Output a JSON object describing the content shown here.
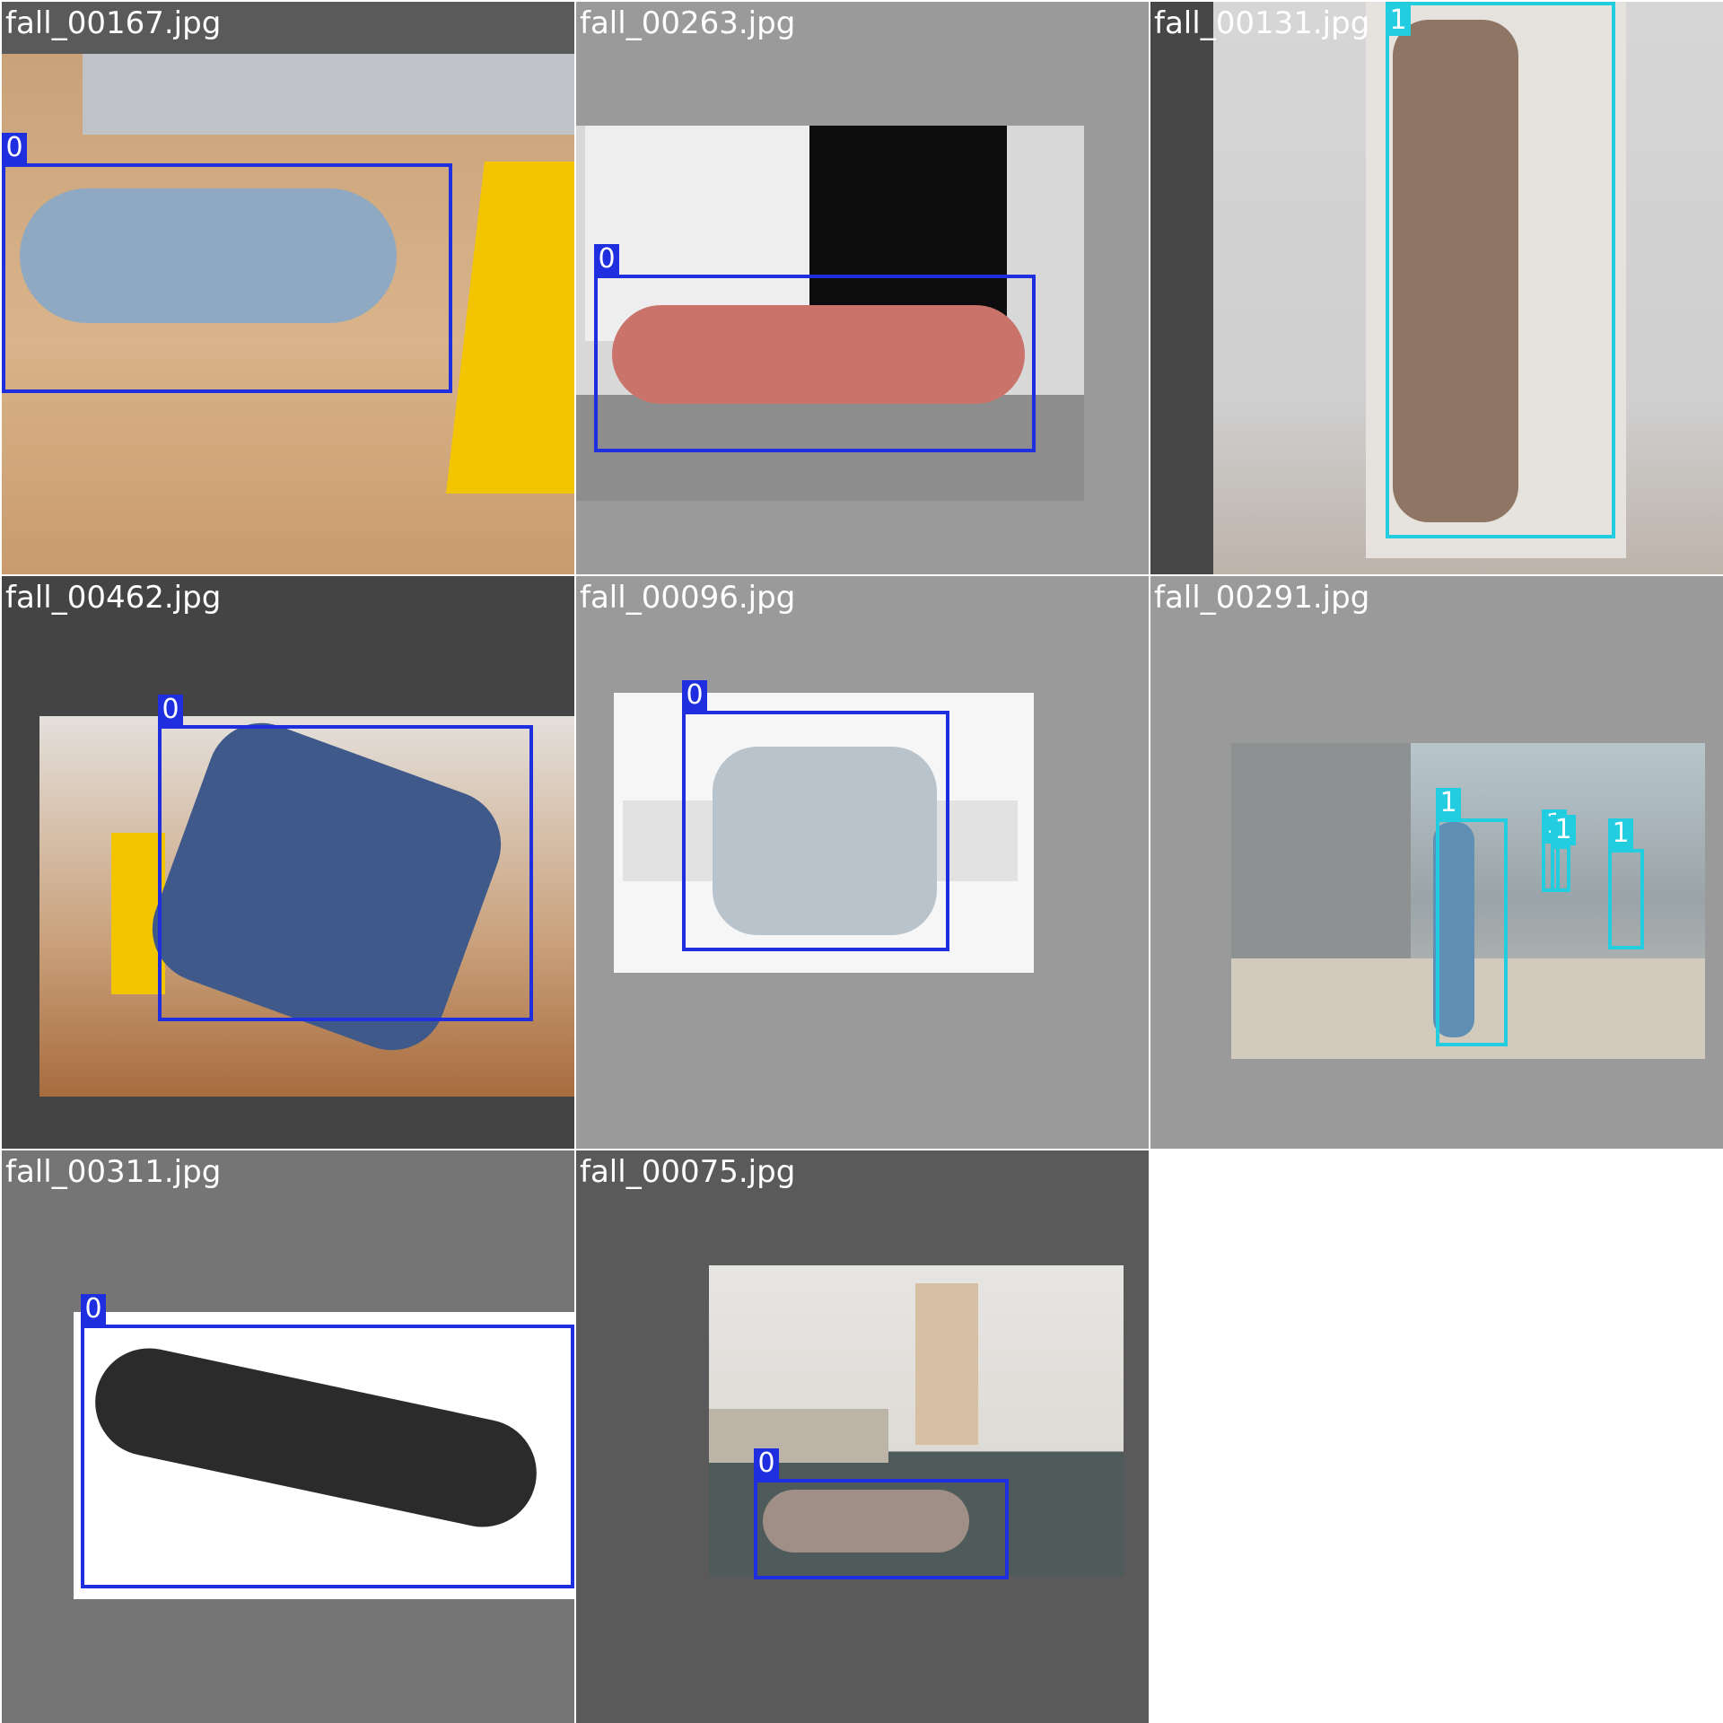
{
  "class_colors": {
    "0": "#1f2fe0",
    "1": "#22cde0"
  },
  "tiles": [
    {
      "filename": "fall_00167.jpg",
      "background": "#5a5a5a",
      "boxes": [
        {
          "class_label": "0"
        }
      ]
    },
    {
      "filename": "fall_00263.jpg",
      "background": "#9a9a9a",
      "boxes": [
        {
          "class_label": "0"
        }
      ]
    },
    {
      "filename": "fall_00131.jpg",
      "background": "#474747",
      "boxes": [
        {
          "class_label": "1"
        }
      ]
    },
    {
      "filename": "fall_00462.jpg",
      "background": "#444444",
      "boxes": [
        {
          "class_label": "0"
        }
      ]
    },
    {
      "filename": "fall_00096.jpg",
      "background": "#9a9a9a",
      "boxes": [
        {
          "class_label": "0"
        }
      ]
    },
    {
      "filename": "fall_00291.jpg",
      "background": "#9a9a9a",
      "boxes": [
        {
          "class_label": "1"
        },
        {
          "class_label": "1"
        },
        {
          "class_label": "1"
        },
        {
          "class_label": "1"
        }
      ]
    },
    {
      "filename": "fall_00311.jpg",
      "background": "#757575",
      "boxes": [
        {
          "class_label": "0"
        }
      ]
    },
    {
      "filename": "fall_00075.jpg",
      "background": "#5a5a5a",
      "boxes": [
        {
          "class_label": "0"
        }
      ]
    }
  ]
}
